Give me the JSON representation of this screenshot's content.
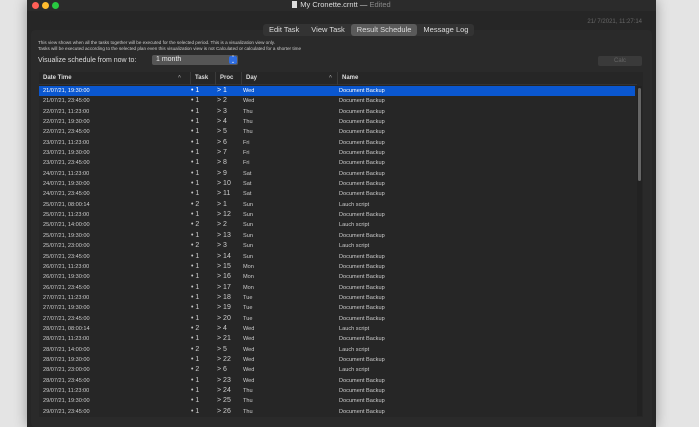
{
  "window": {
    "title": "My Cronette.crntt",
    "edited": "Edited",
    "clock": "21/ 7/2021, 11:27:14"
  },
  "tabs": [
    {
      "label": "Edit Task"
    },
    {
      "label": "View Task"
    },
    {
      "label": "Result Schedule",
      "selected": true
    },
    {
      "label": "Message Log"
    }
  ],
  "info": {
    "line1": "This view shows when all the tasks together will be executed for the selected period. This is a visualization view only.",
    "line2": "Tasks will be executed according to the selected plan even this visualization view is not Calculated or calculated for a shorter time"
  },
  "visualize": {
    "label": "Visualize schedule from now to:",
    "value": "1 month",
    "calc_label": "Calc"
  },
  "table": {
    "headers": {
      "datetime": "Date Time",
      "task": "Task",
      "proc": "Proc",
      "day": "Day",
      "name": "Name"
    },
    "rows": [
      [
        "21/07/21, 19:30:00",
        "1",
        "1",
        "Wed",
        "Document Backup"
      ],
      [
        "21/07/21, 23:45:00",
        "1",
        "2",
        "Wed",
        "Document Backup"
      ],
      [
        "22/07/21, 11:23:00",
        "1",
        "3",
        "Thu",
        "Document Backup"
      ],
      [
        "22/07/21, 19:30:00",
        "1",
        "4",
        "Thu",
        "Document Backup"
      ],
      [
        "22/07/21, 23:45:00",
        "1",
        "5",
        "Thu",
        "Document Backup"
      ],
      [
        "23/07/21, 11:23:00",
        "1",
        "6",
        "Fri",
        "Document Backup"
      ],
      [
        "23/07/21, 19:30:00",
        "1",
        "7",
        "Fri",
        "Document Backup"
      ],
      [
        "23/07/21, 23:45:00",
        "1",
        "8",
        "Fri",
        "Document Backup"
      ],
      [
        "24/07/21, 11:23:00",
        "1",
        "9",
        "Sat",
        "Document Backup"
      ],
      [
        "24/07/21, 19:30:00",
        "1",
        "10",
        "Sat",
        "Document Backup"
      ],
      [
        "24/07/21, 23:45:00",
        "1",
        "11",
        "Sat",
        "Document Backup"
      ],
      [
        "25/07/21, 08:00:14",
        "2",
        "1",
        "Sun",
        "Lauch script"
      ],
      [
        "25/07/21, 11:23:00",
        "1",
        "12",
        "Sun",
        "Document Backup"
      ],
      [
        "25/07/21, 14:00:00",
        "2",
        "2",
        "Sun",
        "Lauch script"
      ],
      [
        "25/07/21, 19:30:00",
        "1",
        "13",
        "Sun",
        "Document Backup"
      ],
      [
        "25/07/21, 23:00:00",
        "2",
        "3",
        "Sun",
        "Lauch script"
      ],
      [
        "25/07/21, 23:45:00",
        "1",
        "14",
        "Sun",
        "Document Backup"
      ],
      [
        "26/07/21, 11:23:00",
        "1",
        "15",
        "Mon",
        "Document Backup"
      ],
      [
        "26/07/21, 19:30:00",
        "1",
        "16",
        "Mon",
        "Document Backup"
      ],
      [
        "26/07/21, 23:45:00",
        "1",
        "17",
        "Mon",
        "Document Backup"
      ],
      [
        "27/07/21, 11:23:00",
        "1",
        "18",
        "Tue",
        "Document Backup"
      ],
      [
        "27/07/21, 19:30:00",
        "1",
        "19",
        "Tue",
        "Document Backup"
      ],
      [
        "27/07/21, 23:45:00",
        "1",
        "20",
        "Tue",
        "Document Backup"
      ],
      [
        "28/07/21, 08:00:14",
        "2",
        "4",
        "Wed",
        "Lauch script"
      ],
      [
        "28/07/21, 11:23:00",
        "1",
        "21",
        "Wed",
        "Document Backup"
      ],
      [
        "28/07/21, 14:00:00",
        "2",
        "5",
        "Wed",
        "Lauch script"
      ],
      [
        "28/07/21, 19:30:00",
        "1",
        "22",
        "Wed",
        "Document Backup"
      ],
      [
        "28/07/21, 23:00:00",
        "2",
        "6",
        "Wed",
        "Lauch script"
      ],
      [
        "28/07/21, 23:45:00",
        "1",
        "23",
        "Wed",
        "Document Backup"
      ],
      [
        "29/07/21, 11:23:00",
        "1",
        "24",
        "Thu",
        "Document Backup"
      ],
      [
        "29/07/21, 19:30:00",
        "1",
        "25",
        "Thu",
        "Document Backup"
      ],
      [
        "29/07/21, 23:45:00",
        "1",
        "26",
        "Thu",
        "Document Backup"
      ]
    ]
  },
  "colors": {
    "selection": "#0a57d0",
    "close": "#ff5f57",
    "minimize": "#febc2e",
    "zoom": "#28c840"
  }
}
